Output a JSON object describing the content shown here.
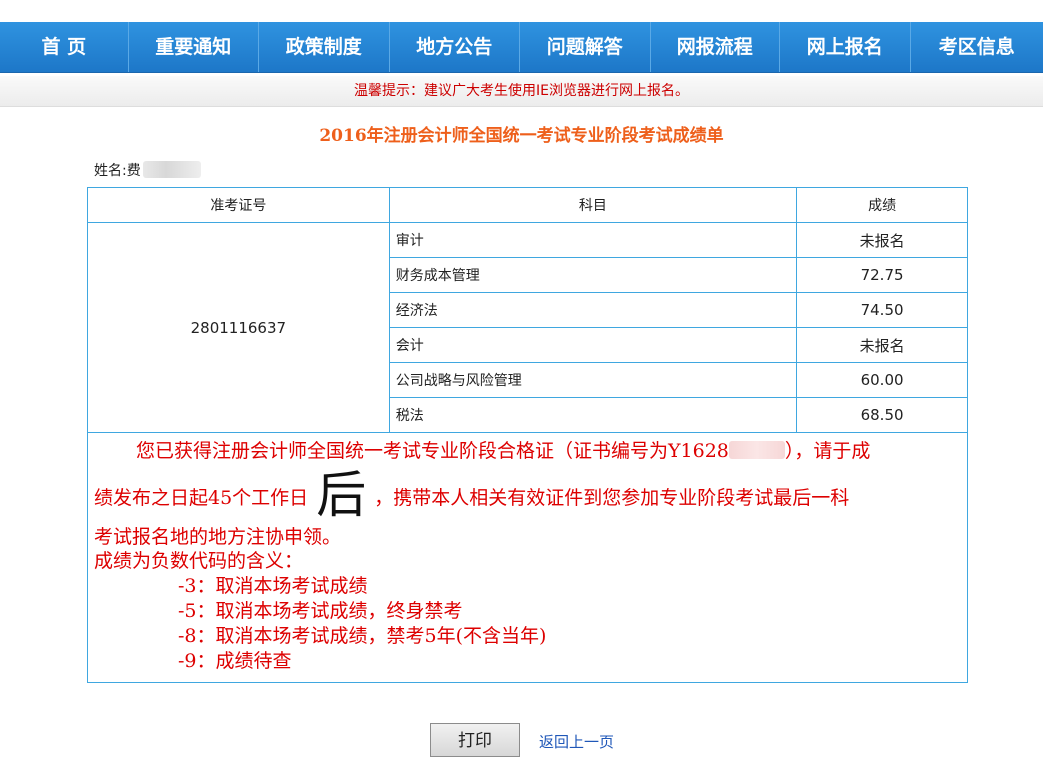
{
  "nav": {
    "items": [
      "首 页",
      "重要通知",
      "政策制度",
      "地方公告",
      "问题解答",
      "网报流程",
      "网上报名",
      "考区信息"
    ]
  },
  "notice": {
    "text": "温馨提示：建议广大考生使用IE浏览器进行网上报名。"
  },
  "page_title": "2016年注册会计师全国统一考试专业阶段考试成绩单",
  "candidate": {
    "name_label": "姓名:",
    "name_visible": "费"
  },
  "table": {
    "headers": {
      "exam_no": "准考证号",
      "subject": "科目",
      "score": "成绩"
    },
    "exam_no": "2801116637",
    "rows": [
      {
        "subject": "审计",
        "score": "未报名"
      },
      {
        "subject": "财务成本管理",
        "score": "72.75"
      },
      {
        "subject": "经济法",
        "score": "74.50"
      },
      {
        "subject": "会计",
        "score": "未报名"
      },
      {
        "subject": "公司战略与风险管理",
        "score": "60.00"
      },
      {
        "subject": "税法",
        "score": "68.50"
      }
    ]
  },
  "message": {
    "line1_a": "您已获得注册会计师全国统一考试专业阶段合格证（证书编号为Y1628",
    "line1_b": "），请于成",
    "line2_a": "绩发布之日起45个工作日",
    "line2_big": "后",
    "line2_b": "，携带本人相关有效证件到您参加专业阶段考试最后一科",
    "line3": "考试报名地的地方注协申领。",
    "legend_title": "成绩为负数代码的含义：",
    "codes": [
      "-3：取消本场考试成绩",
      "-5：取消本场考试成绩，终身禁考",
      "-8：取消本场考试成绩，禁考5年(不含当年)",
      "-9：成绩待查"
    ]
  },
  "actions": {
    "print_label": "打印",
    "back_label": "返回上一页"
  },
  "colors": {
    "nav_bg": "#1d77c8",
    "title": "#ee5f1b",
    "message": "#dd0000",
    "table_border": "#3fa7e0"
  }
}
